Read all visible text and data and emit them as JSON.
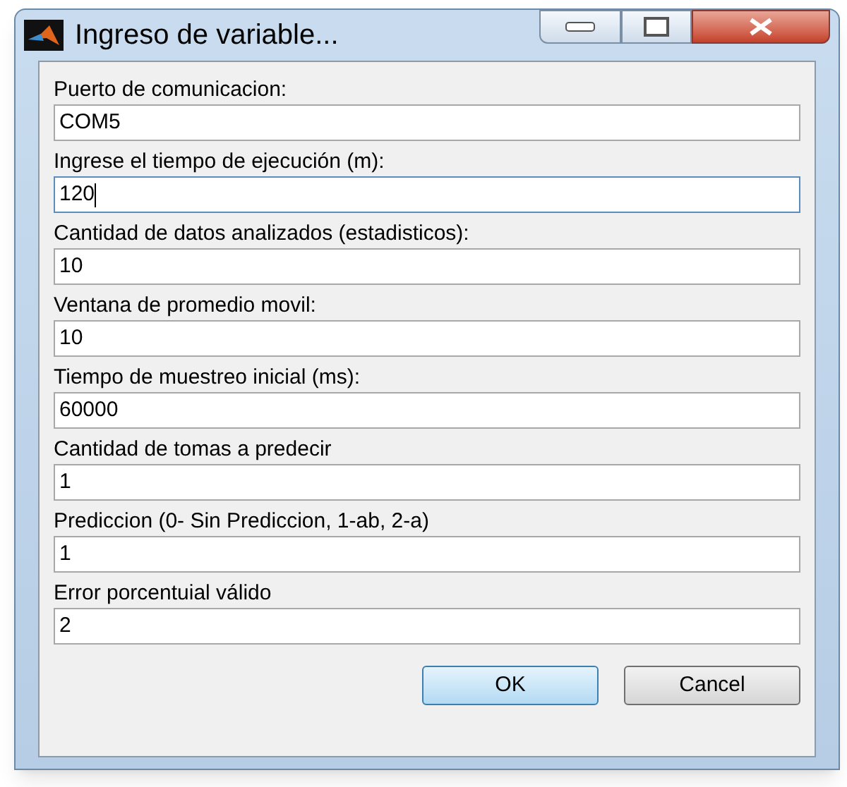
{
  "window": {
    "title": "Ingreso de variable..."
  },
  "fields": [
    {
      "label": "Puerto de comunicacion:",
      "value": "COM5",
      "focused": false
    },
    {
      "label": "Ingrese el tiempo de ejecución (m):",
      "value": "120",
      "focused": true
    },
    {
      "label": "Cantidad de datos analizados (estadisticos):",
      "value": "10",
      "focused": false
    },
    {
      "label": "Ventana de promedio movil:",
      "value": "10",
      "focused": false
    },
    {
      "label": "Tiempo de muestreo inicial (ms):",
      "value": "60000",
      "focused": false
    },
    {
      "label": "Cantidad de tomas a predecir",
      "value": "1",
      "focused": false
    },
    {
      "label": "Prediccion (0- Sin Prediccion, 1-ab, 2-a)",
      "value": "1",
      "focused": false
    },
    {
      "label": "Error porcentuial válido",
      "value": "2",
      "focused": false
    }
  ],
  "buttons": [
    {
      "label": "OK",
      "default": true
    },
    {
      "label": "Cancel",
      "default": false
    }
  ]
}
